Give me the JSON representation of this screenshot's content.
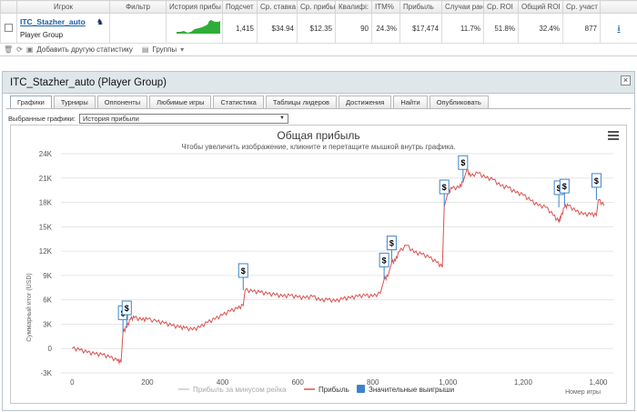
{
  "stats_table": {
    "headers": [
      "Игрок",
      "Фильтр",
      "История прибы",
      "Подсчет",
      "Ср. ставка",
      "Ср. прибы",
      "Квалифі:",
      "ITM%",
      "Прибыль",
      "Случаи ран",
      "Ср. ROI",
      "Общий ROI",
      "Ср. участ"
    ],
    "row": {
      "player_name": "ITC_Stazher_auto",
      "player_group": "Player Group",
      "filter": "",
      "count": "1,415",
      "avg_stake": "$34.94",
      "avg_profit": "$12.35",
      "qualified": "90",
      "itm": "24.3%",
      "profit": "$17,474",
      "random_cases": "11.7%",
      "avg_roi": "51.8%",
      "total_roi": "32.4%",
      "avg_entrants": "877"
    },
    "toolbar": {
      "add_stats": "Добавить другую статистику",
      "groups": "Группы"
    }
  },
  "window": {
    "title": "ITC_Stazher_auto (Player Group)",
    "tabs": [
      "Графики",
      "Турниры",
      "Оппоненты",
      "Любимые игры",
      "Статистика",
      "Таблицы лидеров",
      "Достижения",
      "Найти",
      "Опубликовать"
    ],
    "active_tab": 0,
    "selector_label": "Выбранные графики:",
    "selector_value": "История прибыли"
  },
  "colors": {
    "profit_line": "#d9534f",
    "ex_rake_line": "#bbbbbb",
    "big_win_marker": "#3d83c8",
    "sparkline": "#2eae38"
  },
  "chart_data": {
    "type": "line",
    "title": "Общая прибыль",
    "subtitle": "Чтобы увеличить изображение, кликните и перетащите мышкой внутрь графика.",
    "xlabel": "Номер игры",
    "ylabel": "Суммарный итог (USD)",
    "xlim": [
      0,
      1415
    ],
    "ylim": [
      -3000,
      24000
    ],
    "x_ticks": [
      "0",
      "200",
      "400",
      "600",
      "800",
      "1,000",
      "1,200",
      "1,400"
    ],
    "y_ticks": [
      "-3K",
      "0",
      "3K",
      "6K",
      "9K",
      "12K",
      "15K",
      "18K",
      "21K",
      "24K"
    ],
    "legend": [
      "Прибыль за минусом рейка",
      "Прибыль",
      "Значительные выигрыши"
    ],
    "series": [
      {
        "name": "Прибыль",
        "x": [
          0,
          20,
          40,
          60,
          80,
          100,
          120,
          130,
          135,
          145,
          155,
          165,
          185,
          200,
          225,
          245,
          265,
          285,
          300,
          320,
          340,
          360,
          380,
          400,
          420,
          440,
          455,
          460,
          480,
          500,
          520,
          540,
          560,
          580,
          600,
          620,
          640,
          660,
          680,
          700,
          720,
          740,
          760,
          780,
          800,
          820,
          830,
          840,
          850,
          860,
          870,
          890,
          910,
          930,
          950,
          970,
          985,
          990,
          1000,
          1010,
          1030,
          1040,
          1050,
          1060,
          1080,
          1100,
          1120,
          1140,
          1160,
          1180,
          1200,
          1220,
          1240,
          1260,
          1280,
          1295,
          1300,
          1310,
          1320,
          1340,
          1360,
          1380,
          1395,
          1400,
          1415
        ],
        "y": [
          0,
          -200,
          -500,
          -700,
          -800,
          -1100,
          -1500,
          -1700,
          2000,
          2600,
          3600,
          3800,
          3500,
          3600,
          3300,
          3100,
          2800,
          2600,
          2500,
          2300,
          2600,
          3200,
          3600,
          4100,
          4600,
          4900,
          5300,
          7200,
          7000,
          6900,
          6700,
          6600,
          6400,
          6500,
          6300,
          6200,
          6400,
          5900,
          6000,
          5800,
          6100,
          6200,
          6400,
          6500,
          6400,
          6800,
          8500,
          8900,
          10600,
          10800,
          11900,
          12700,
          11800,
          11600,
          11200,
          10600,
          10000,
          17500,
          19200,
          19700,
          19800,
          20500,
          22000,
          21200,
          21600,
          21000,
          20800,
          20000,
          19800,
          19200,
          18900,
          18200,
          17600,
          17400,
          16400,
          15600,
          16100,
          17400,
          17600,
          16900,
          16500,
          16500,
          16400,
          18300,
          17600
        ]
      },
      {
        "name": "Значительные выигрыши",
        "x": [
          135,
          145,
          455,
          830,
          850,
          990,
          1040,
          1295,
          1310,
          1395
        ],
        "y": [
          2000,
          2600,
          7200,
          8500,
          10600,
          17500,
          20500,
          17400,
          17600,
          18300
        ]
      }
    ]
  }
}
